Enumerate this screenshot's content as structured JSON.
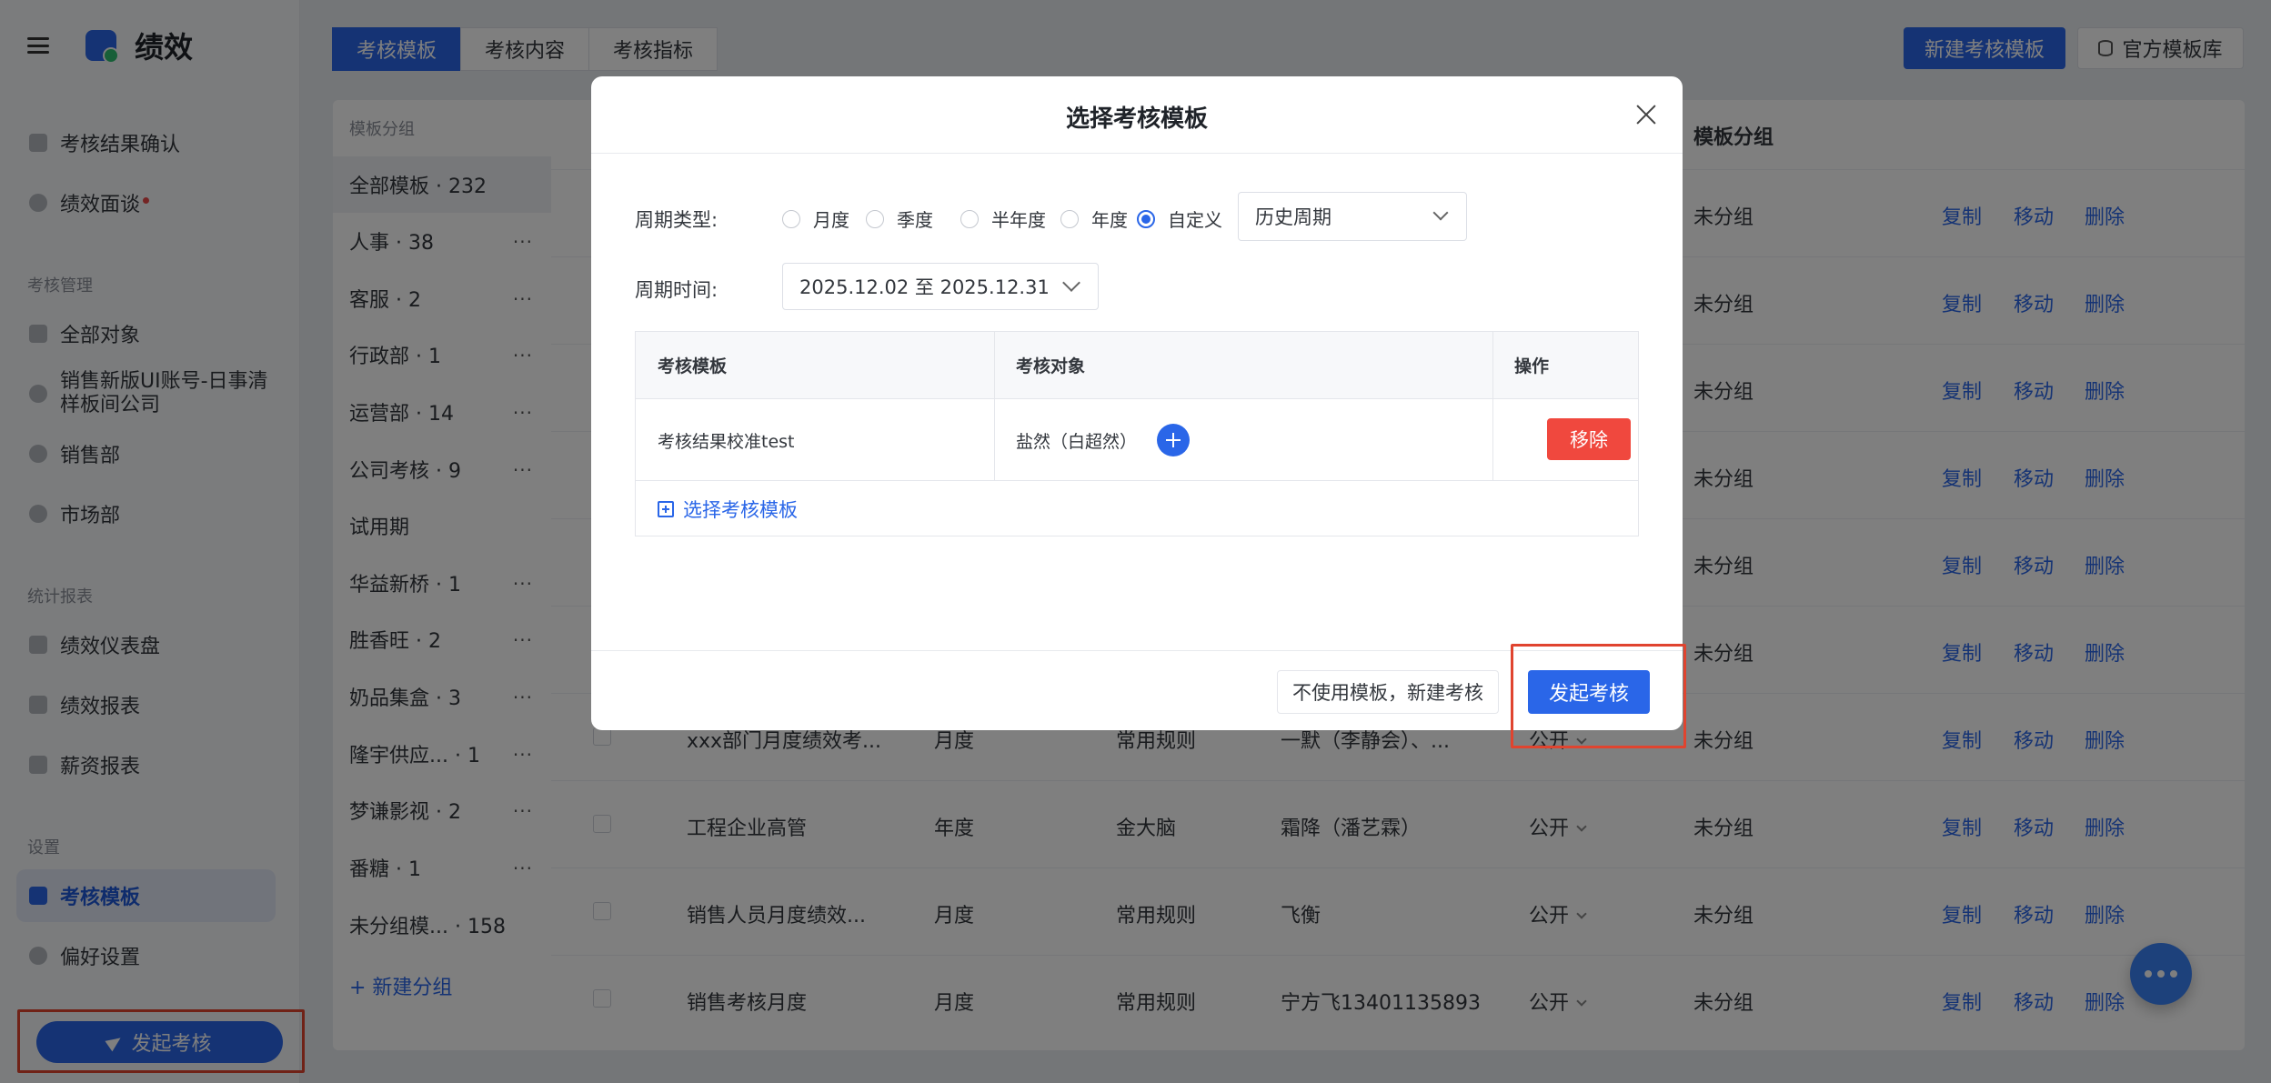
{
  "app": {
    "title": "绩效"
  },
  "sidebar": {
    "items": [
      {
        "label": "考核结果确认"
      },
      {
        "label": "绩效面谈"
      }
    ],
    "section_manage": "考核管理",
    "manage_items": [
      {
        "label": "全部对象"
      },
      {
        "label": "销售新版UI账号-日事清样板间公司"
      },
      {
        "label": "销售部"
      },
      {
        "label": "市场部"
      }
    ],
    "section_stats": "统计报表",
    "stats_items": [
      {
        "label": "绩效仪表盘"
      },
      {
        "label": "绩效报表"
      },
      {
        "label": "薪资报表"
      }
    ],
    "section_settings": "设置",
    "settings_items": [
      {
        "label": "考核模板"
      },
      {
        "label": "偏好设置"
      }
    ],
    "launch_button": "发起考核"
  },
  "top": {
    "tabs": [
      "考核模板",
      "考核内容",
      "考核指标"
    ],
    "new_template_button": "新建考核模板",
    "official_library_button": "官方模板库"
  },
  "groups": {
    "header": "模板分组",
    "items": [
      {
        "label": "全部模板 · 232"
      },
      {
        "label": "人事 · 38"
      },
      {
        "label": "客服 · 2"
      },
      {
        "label": "行政部 · 1"
      },
      {
        "label": "运营部 · 14"
      },
      {
        "label": "公司考核 · 9"
      },
      {
        "label": "试用期"
      },
      {
        "label": "华益新桥 · 1"
      },
      {
        "label": "胜香旺 · 2"
      },
      {
        "label": "奶品集盒 · 3"
      },
      {
        "label": "隆宇供应...    · 1"
      },
      {
        "label": "梦谦影视 · 2"
      },
      {
        "label": "番糖 · 1"
      },
      {
        "label": "未分组模... · 158"
      }
    ],
    "more": "···",
    "new_group": "+ 新建分组"
  },
  "table": {
    "header_group": "模板分组",
    "actions": {
      "copy": "复制",
      "move": "移动",
      "delete": "删除"
    },
    "group_value": "未分组",
    "visible_rows": [
      {
        "name": "xxx部门月度绩效考...",
        "cycle": "月度",
        "rule": "常用规则",
        "owner": "一默（李静会）、...",
        "visibility": "公开"
      },
      {
        "name": "工程企业高管",
        "cycle": "年度",
        "rule": "金大脑",
        "owner": "霜降（潘艺霖）",
        "visibility": "公开"
      },
      {
        "name": "销售人员月度绩效...",
        "cycle": "月度",
        "rule": "常用规则",
        "owner": "飞衡",
        "visibility": "公开"
      },
      {
        "name": "销售考核月度",
        "cycle": "月度",
        "rule": "常用规则",
        "owner": "宁方飞13401135893",
        "visibility": "公开"
      }
    ]
  },
  "modal": {
    "title": "选择考核模板",
    "cycle_type_label": "周期类型:",
    "cycle_options": [
      "月度",
      "季度",
      "半年度",
      "年度",
      "自定义"
    ],
    "cycle_selected": "自定义",
    "history_select": "历史周期",
    "cycle_time_label": "周期时间:",
    "cycle_time_value": "2025.12.02 至 2025.12.31",
    "columns": [
      "考核模板",
      "考核对象",
      "操作"
    ],
    "row": {
      "template": "考核结果校准test",
      "target": "盐然（白超然）",
      "remove": "移除"
    },
    "add_template": "选择考核模板",
    "no_template_button": "不使用模板，新建考核",
    "launch_button": "发起考核"
  }
}
